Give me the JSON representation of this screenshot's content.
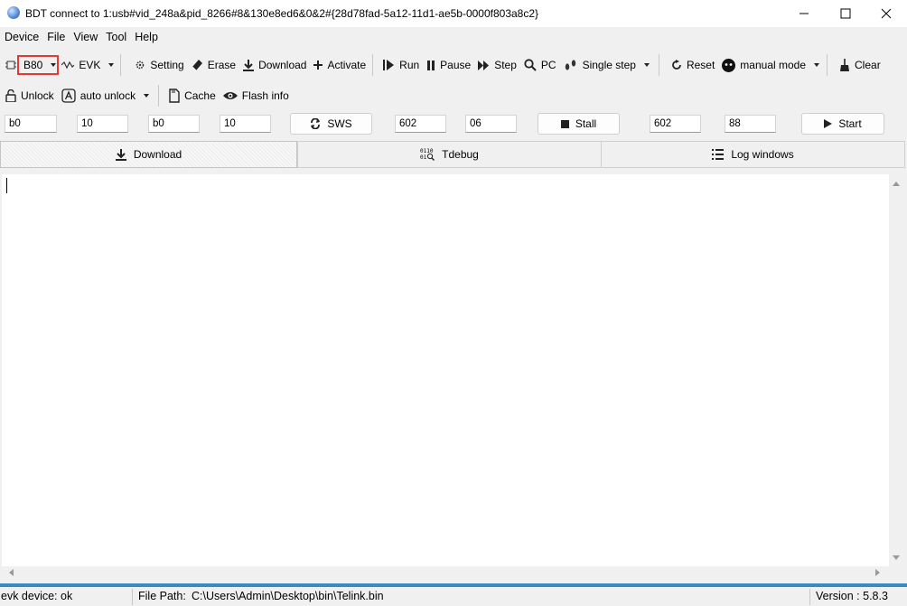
{
  "window": {
    "title": "BDT connect to 1:usb#vid_248a&pid_8266#8&130e8ed6&0&2#{28d78fad-5a12-11d1-ae5b-0000f803a8c2}"
  },
  "menu": [
    "Device",
    "File",
    "View",
    "Tool",
    "Help"
  ],
  "toolbar1": {
    "chip": "B80",
    "board": "EVK",
    "setting": "Setting",
    "erase": "Erase",
    "download": "Download",
    "activate": "Activate",
    "run": "Run",
    "pause": "Pause",
    "step": "Step",
    "pc": "PC",
    "single_step": "Single step",
    "reset": "Reset",
    "manual_mode": "manual mode",
    "clear": "Clear"
  },
  "toolbar2": {
    "unlock": "Unlock",
    "auto_unlock": "auto unlock",
    "cache": "Cache",
    "flash_info": "Flash info"
  },
  "toolbar3": {
    "field1": "b0",
    "field2": "10",
    "field3": "b0",
    "field4": "10",
    "sws": "SWS",
    "field5": "602",
    "field6": "06",
    "stall": "Stall",
    "field7": "602",
    "field8": "88",
    "start": "Start"
  },
  "tabs": [
    "Download",
    "Tdebug",
    "Log windows"
  ],
  "status": {
    "device": "evk device: ok",
    "file_path_label": "File Path:",
    "file_path": "C:\\Users\\Admin\\Desktop\\bin\\Telink.bin",
    "version": "Version : 5.8.3"
  },
  "icons": {
    "app": "globe-icon",
    "highlight_color": "#e53935",
    "accent_line": "#3c8ac2"
  }
}
